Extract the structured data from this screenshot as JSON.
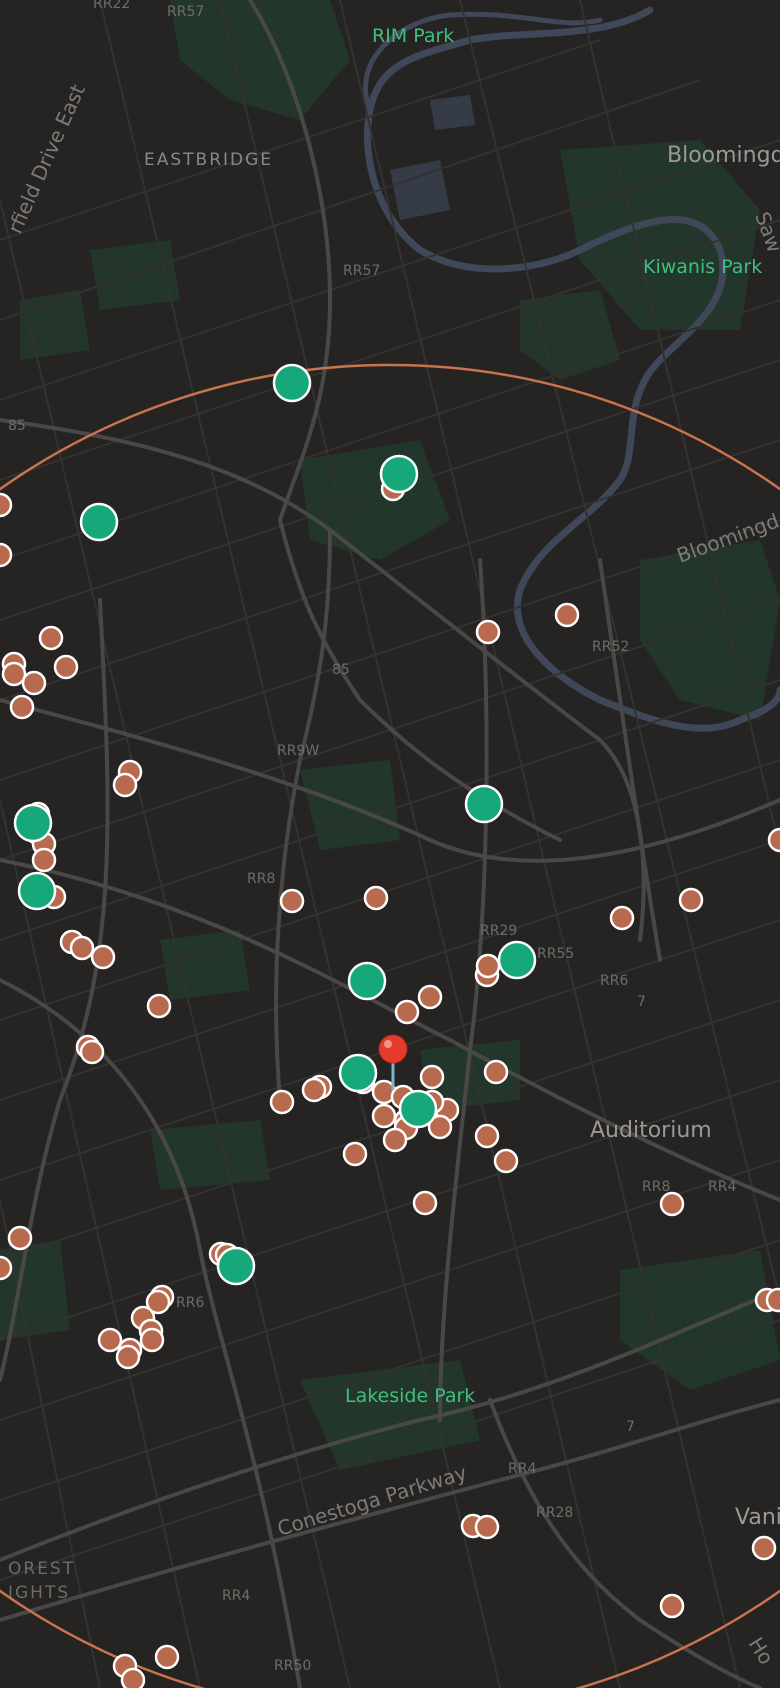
{
  "map": {
    "parks": [
      {
        "name": "RIM Park"
      },
      {
        "name": "Kiwanis Park"
      },
      {
        "name": "Lakeside Park"
      }
    ],
    "neighbourhoods": [
      {
        "name": "EASTBRIDGE"
      },
      {
        "name": "Bloomingd"
      },
      {
        "name": "Auditorium"
      },
      {
        "name": "Vani"
      },
      {
        "name": "OREST"
      },
      {
        "name": "IGHTS"
      }
    ],
    "streets": [
      {
        "name": "rfield Drive East"
      },
      {
        "name": "Bloomingd"
      },
      {
        "name": "Conestoga Parkway"
      },
      {
        "name": "Saw"
      },
      {
        "name": "Ho"
      }
    ],
    "route_shields": [
      "RR22",
      "RR57",
      "RR57",
      "85",
      "RR52",
      "85",
      "RR9W",
      "RR8",
      "RR29",
      "RR55",
      "RR6",
      "7",
      "RR8",
      "RR4",
      "RR6",
      "RR4",
      "RR28",
      "7",
      "RR4",
      "RR50"
    ],
    "search_radius": {
      "color": "#c9734f"
    },
    "center_pin": {
      "color": "#e53b2c"
    },
    "marker_colors": {
      "orange": "#b86a4e",
      "green": "#16a87a",
      "stroke": "#ffffff"
    }
  }
}
